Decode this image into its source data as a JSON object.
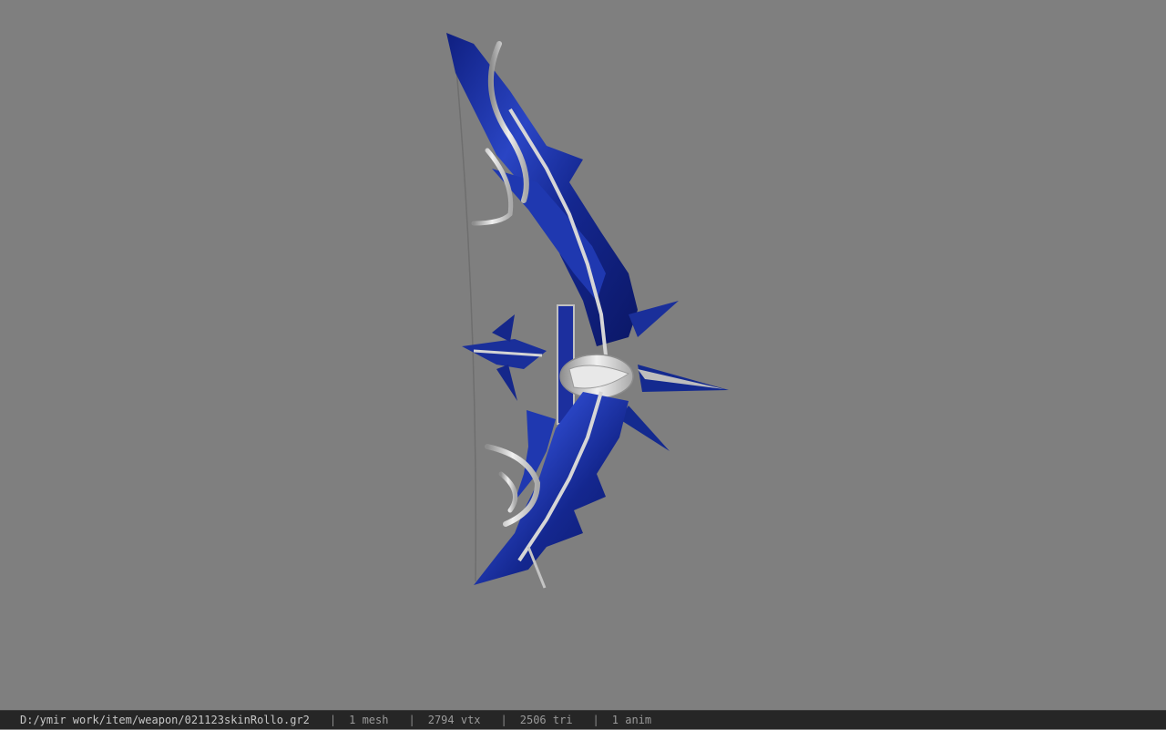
{
  "viewer": {
    "background_color": "#7f7f7f",
    "model": {
      "icon": "bow-model",
      "primary_color": "#1a2f9a",
      "metal_color": "#c9c9c9"
    }
  },
  "statusbar": {
    "file_path": "D:/ymir work/item/weapon/021123skinRollo.gr2",
    "separator": "|",
    "stats": [
      "1 mesh",
      "2794 vtx",
      "2506 tri",
      "1 anim"
    ]
  }
}
